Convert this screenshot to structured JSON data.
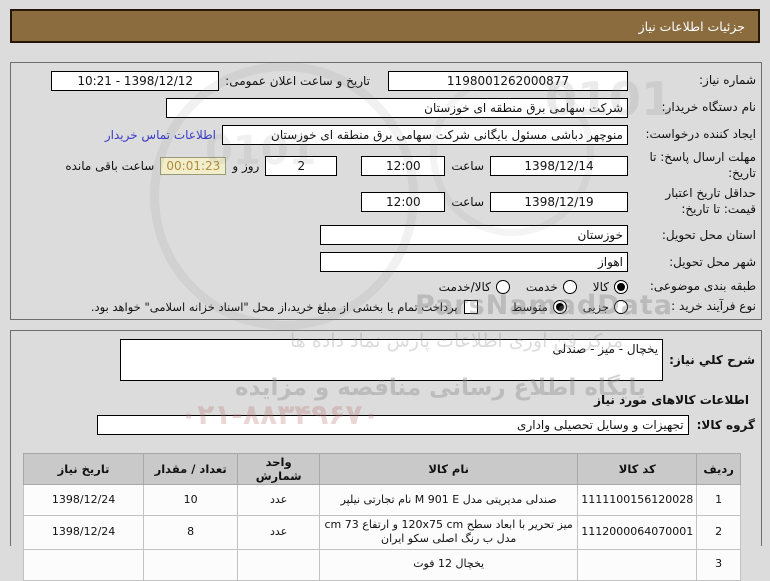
{
  "colors": {
    "titlebar_bg": "#8a6c3f",
    "countdown_bg": "#f2eecb",
    "countdown_text": "#b08c3e",
    "link": "#3a3ac8",
    "table_header_bg": "#c9c9c9"
  },
  "title_bar": {
    "label": "جزئیات اطلاعات نیاز"
  },
  "form": {
    "need_number": {
      "label": "شماره نیاز:",
      "value": "1198001262000877"
    },
    "announce": {
      "label": "تاریخ و ساعت اعلان عمومی:",
      "value": "1398/12/12 - 10:21"
    },
    "buyer_org": {
      "label": "نام دستگاه خریدار:",
      "value": "شرکت سهامی برق منطقه ای خوزستان"
    },
    "creator": {
      "label": "ایجاد کننده درخواست:",
      "value": "منوچهر دباشی مسئول بایگانی شرکت سهامی برق منطقه ای خوزستان",
      "contact_link": "اطلاعات تماس خریدار"
    },
    "deadline": {
      "label": "مهلت ارسال پاسخ: تا تاریخ:",
      "date": "1398/12/14",
      "hour_label": "ساعت",
      "time": "12:00",
      "days": "2",
      "days_label": "روز و",
      "remaining": "00:01:23",
      "remaining_label": "ساعت باقی مانده"
    },
    "validity": {
      "label": "حداقل تاریخ اعتبار قیمت: تا تاریخ:",
      "date": "1398/12/19",
      "hour_label": "ساعت",
      "time": "12:00"
    },
    "province": {
      "label": "استان محل تحویل:",
      "value": "خوزستان"
    },
    "city": {
      "label": "شهر محل تحویل:",
      "value": "اهواز"
    },
    "subject_class": {
      "label": "طبقه بندی موضوعی:",
      "options": [
        {
          "label": "کالا",
          "selected": true
        },
        {
          "label": "خدمت",
          "selected": false
        },
        {
          "label": "کالا/خدمت",
          "selected": false
        }
      ]
    },
    "purchase_type": {
      "label": "نوع فرآیند خرید :",
      "options": [
        {
          "label": "جزیی",
          "selected": false
        },
        {
          "label": "متوسط",
          "selected": true
        }
      ],
      "note_checkbox": {
        "label": "پرداخت تمام یا بخشی از مبلغ خرید،از محل \"اسناد خزانه اسلامی\" خواهد بود.",
        "checked": false
      }
    }
  },
  "description": {
    "label": "شرح كلي نياز:",
    "value": "یخچال - میز - صندلی"
  },
  "goods": {
    "heading": "اطلاعات کالاهای مورد نیاز",
    "group_label": "گروه کالا:",
    "group_value": "تجهیزات و وسایل تحصیلی واداری"
  },
  "table": {
    "headers": [
      "ردیف",
      "کد کالا",
      "نام کالا",
      "واحد شمارش",
      "تعداد / مقدار",
      "تاریخ نیاز"
    ],
    "rows": [
      {
        "row": "1",
        "code": "1111100156120028",
        "name": "صندلی مدیریتی مدل M 901 E نام تجارتی نیلپر",
        "unit": "عدد",
        "qty": "10",
        "date": "1398/12/24"
      },
      {
        "row": "2",
        "code": "1112000064070001",
        "name": "میز تحریر با ابعاد سطح 120x75 cm و ارتفاع 73 cm مدل ب رنگ اصلی سکو ایران",
        "unit": "عدد",
        "qty": "8",
        "date": "1398/12/24"
      },
      {
        "row": "3",
        "code": "",
        "name": "یخچال 12 فوت",
        "unit": "",
        "qty": "",
        "date": ""
      }
    ]
  },
  "watermark": {
    "brand_latin": "ParsNamadData",
    "brand_fa": "مرکز فن آوری اطلاعات پارس نماد داده ها",
    "site_fa": "پایگاه اطلاع رسانی مناقصه و مزایده",
    "phone": "۰۲۱-۸۸۳۴۹۶۷۰",
    "digits": "0101"
  }
}
